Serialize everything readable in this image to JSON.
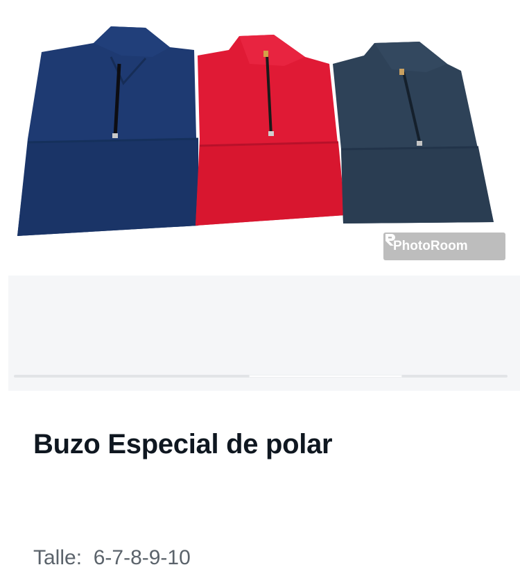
{
  "product": {
    "title": "Buzo Especial de polar",
    "size_label": "Talle:",
    "size_values": "6-7-8-9-10",
    "image_alt": "three folded fleece quarter-zip sweaters in navy, red and dark grey",
    "watermark_text": "PhotoRoom"
  },
  "gallery": {
    "scroll_position": 0.69,
    "scroll_thumb_fraction": 0.31
  },
  "colors": {
    "navy": "#1e3a72",
    "red": "#e01a35",
    "charcoal": "#2e4258",
    "title_text": "#0f1720",
    "muted_text": "#5b636b"
  }
}
